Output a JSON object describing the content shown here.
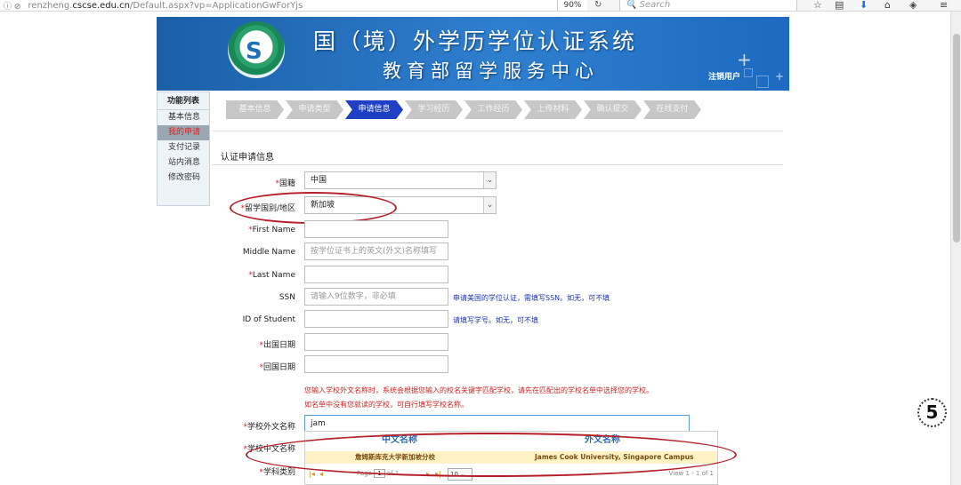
{
  "browser": {
    "url_prefix": "renzheng.",
    "url_host": "cscse.edu.cn",
    "url_path": "/Default.aspx?vp=ApplicationGwForYjs",
    "zoom": "90%",
    "search_placeholder": "Search"
  },
  "banner": {
    "title": "国（境）外学历学位认证系统",
    "subtitle": "教育部留学服务中心",
    "logout": "注销用户"
  },
  "menu": {
    "heading": "功能列表",
    "items": [
      "基本信息",
      "我的申请",
      "支付记录",
      "站内消息",
      "修改密码"
    ]
  },
  "steps": [
    "基本信息",
    "申请类型",
    "申请信息",
    "学习经历",
    "工作经历",
    "上传材料",
    "确认提交",
    "在线支付"
  ],
  "form": {
    "section_title": "认证申请信息",
    "nationality_label": "国籍",
    "nationality_value": "中国",
    "study_country_label": "留学国别/地区",
    "study_country_value": "新加坡",
    "first_name_label": "First Name",
    "middle_name_label": "Middle Name",
    "middle_name_placeholder": "按学位证书上的英文(外文)名称填写",
    "last_name_label": "Last Name",
    "ssn_label": "SSN",
    "ssn_placeholder": "请输入9位数字，非必填",
    "ssn_hint": "申请美国的学位认证，需填写SSN。如无，可不填",
    "student_id_label": "ID of Student",
    "student_id_hint": "请填写学号。如无，可不填",
    "depart_date_label": "出国日期",
    "return_date_label": "回国日期",
    "note_line1": "您输入学校外文名称时，系统会根据您输入的校名关键字匹配学校，请先在匹配出的学校名单中选择您的学校。",
    "note_line2": "如名单中没有您就读的学校，可自行填写学校名称。",
    "school_foreign_label": "学校外文名称",
    "school_foreign_value": "jam",
    "school_cn_label": "学校中文名称",
    "major_label": "学科类别"
  },
  "autocomplete": {
    "header_cn": "中文名称",
    "header_en": "外文名称",
    "row_cn": "詹姆斯库克大学新加坡分校",
    "row_en": "James Cook University, Singapore Campus",
    "page_label": "Page",
    "page_value": "1",
    "page_of": "of 1",
    "page_size": "10",
    "view_text": "View 1 - 1 of 1"
  },
  "badge": "5"
}
